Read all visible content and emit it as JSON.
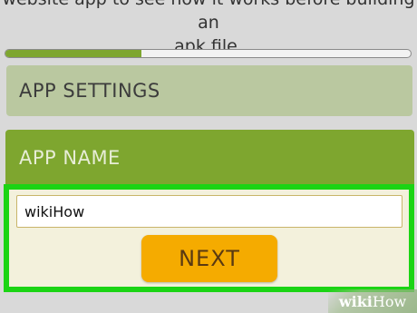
{
  "intro": {
    "line1": "website app to see how it works before building an",
    "line2": "apk file."
  },
  "progress": {
    "fraction": 0.335,
    "fill_color": "#7ea62f"
  },
  "sections": {
    "app_settings": "APP SETTINGS",
    "app_name": "APP NAME"
  },
  "form": {
    "app_name_value": "wikiHow",
    "next_label": "NEXT"
  },
  "watermark": {
    "wiki": "wiki",
    "how": "How"
  },
  "colors": {
    "accent_green": "#7ea62f",
    "highlight_green": "#1bd414",
    "button_orange": "#f5ab00",
    "settings_bg": "#bac8a0",
    "panel_bg": "#f3f1dc"
  }
}
